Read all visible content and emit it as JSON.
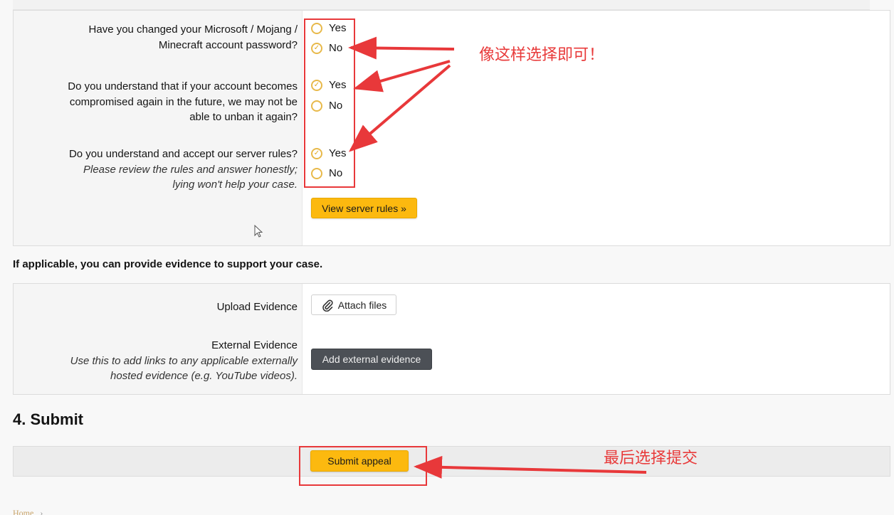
{
  "questions": [
    {
      "label_lines": [
        "Have you changed your Microsoft / Mojang /",
        "Minecraft account password?"
      ],
      "options": [
        "Yes",
        "No"
      ],
      "selected": "No"
    },
    {
      "label_lines": [
        "Do you understand that if your account becomes",
        "compromised again in the future, we may not be",
        "able to unban it again?"
      ],
      "options": [
        "Yes",
        "No"
      ],
      "selected": "Yes"
    },
    {
      "label_lines": [
        "Do you understand and accept our server rules?"
      ],
      "hint_lines": [
        "Please review the rules and answer honestly;",
        "lying won't help your case."
      ],
      "options": [
        "Yes",
        "No"
      ],
      "selected": "Yes"
    }
  ],
  "view_rules_button": "View server rules »",
  "evidence_intro": "If applicable, you can provide evidence to support your case.",
  "evidence": {
    "upload_label": "Upload Evidence",
    "attach_button": "Attach files",
    "external_label": "External Evidence",
    "external_hint_lines": [
      "Use this to add links to any applicable externally",
      "hosted evidence (e.g. YouTube videos)."
    ],
    "add_external_button": "Add external evidence"
  },
  "submit_heading": "4. Submit",
  "submit_button": "Submit appeal",
  "annotations": {
    "choose_like_this": "像这样选择即可！",
    "finally_submit": "最后选择提交"
  },
  "breadcrumb": "Home",
  "colors": {
    "accent_yellow": "#fcb90f",
    "annotation_red": "#e8383a",
    "radio_gold": "#e8b94a",
    "dark_button": "#4c5056"
  }
}
